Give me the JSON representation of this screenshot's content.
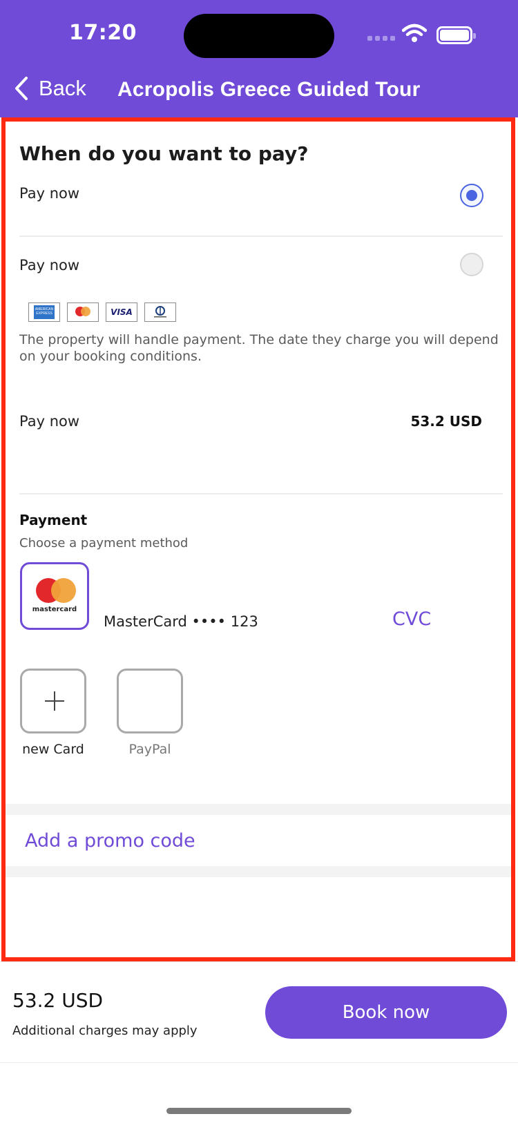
{
  "status_bar": {
    "time": "17:20"
  },
  "nav": {
    "back_label": "Back",
    "title": "Acropolis Greece Guided Tour"
  },
  "payment_timing": {
    "heading": "When do you want to pay?",
    "option1_label": "Pay now",
    "option1_selected": true,
    "option2_label": "Pay now",
    "option2_selected": false,
    "card_brands": [
      "american-express",
      "mastercard",
      "visa",
      "diners-club"
    ],
    "note": "The property will handle payment. The date they charge you will depend on your booking conditions."
  },
  "summary": {
    "label": "Pay now",
    "amount": "53.2 USD"
  },
  "payment": {
    "title": "Payment",
    "subtitle": "Choose a payment method",
    "saved_card": "MasterCard •••• 123",
    "cvc_placeholder": "CVC",
    "new_card_label": "new Card",
    "paypal_label": "PayPal"
  },
  "promo": {
    "label": "Add a promo code"
  },
  "footer": {
    "total": "53.2 USD",
    "note": "Additional charges may apply",
    "book_label": "Book now"
  },
  "colors": {
    "brand": "#6f4bd8",
    "radio_active": "#4a63e0",
    "highlight_frame": "#ff2a12"
  }
}
